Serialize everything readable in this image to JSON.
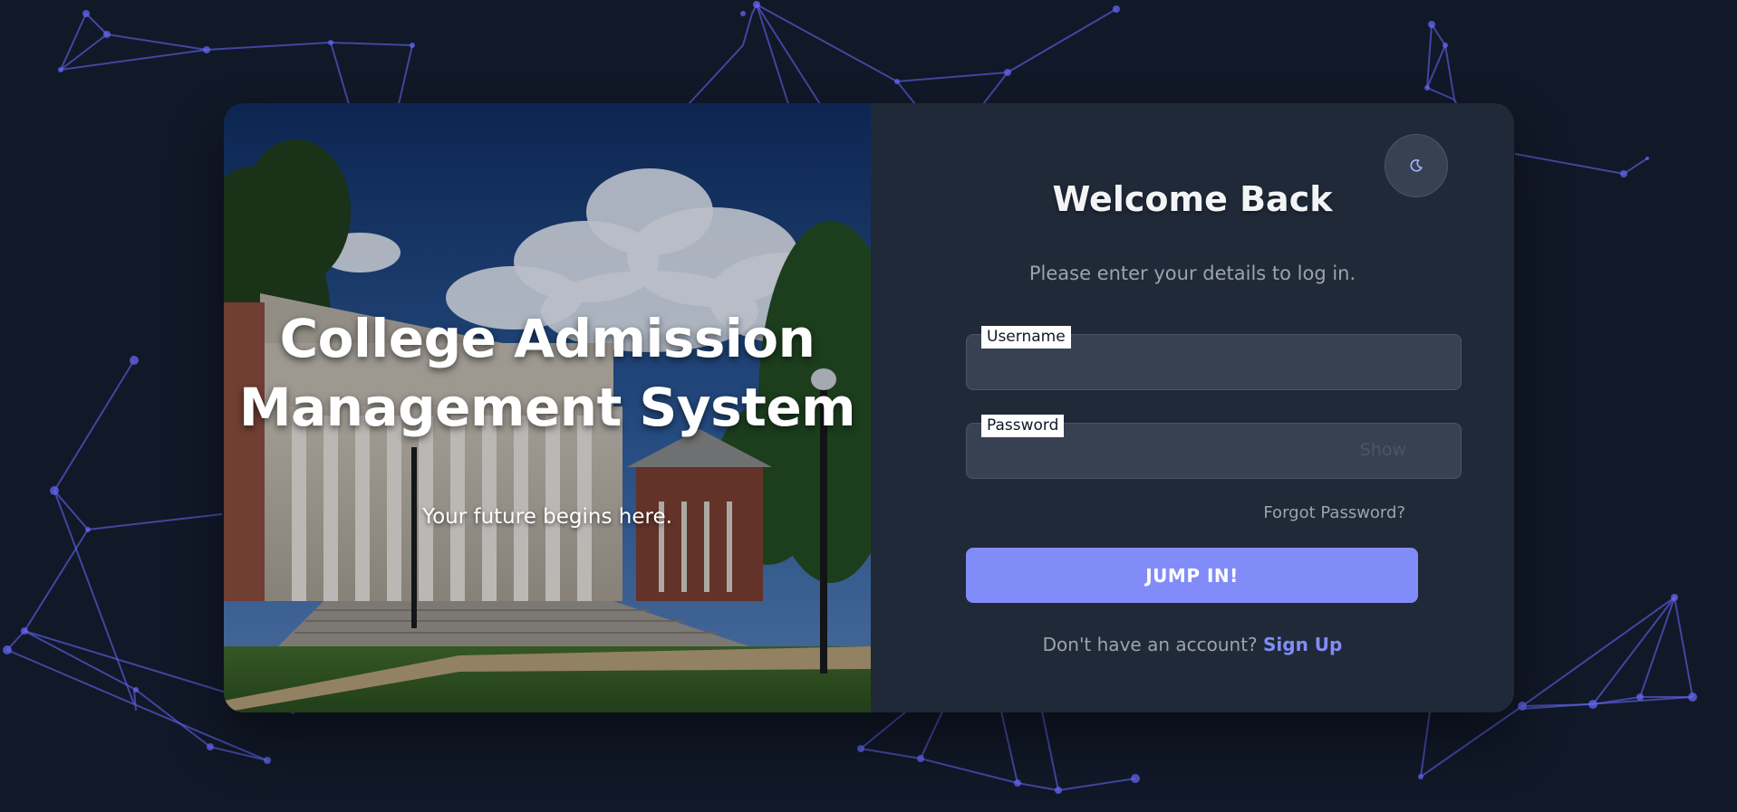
{
  "hero": {
    "title_line1": "College Admission",
    "title_line2": "Management System",
    "tagline": "Your future begins here."
  },
  "login": {
    "theme_toggle_icon": "moon-icon",
    "heading": "Welcome Back",
    "subtitle": "Please enter your details to log in.",
    "username": {
      "label": "Username",
      "value": ""
    },
    "password": {
      "label": "Password",
      "value": "",
      "toggle_label": "Show"
    },
    "forgot_password": "Forgot Password?",
    "submit_label": "JUMP IN!",
    "signup_prompt": "Don't have an account?",
    "signup_link": "Sign Up"
  },
  "colors": {
    "page_background": "#111827",
    "panel_background": "#1f2937",
    "input_background": "#374151",
    "accent": "#818cf8",
    "network_lines": "#6366f1"
  }
}
